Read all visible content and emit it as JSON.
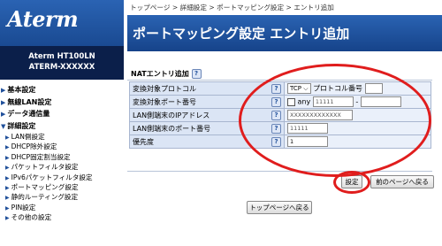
{
  "sidebar": {
    "logo": "Aterm",
    "model_line1": "Aterm  HT100LN",
    "model_line2": "ATERM-XXXXXX",
    "items": [
      {
        "label": "基本設定"
      },
      {
        "label": "無線LAN設定"
      },
      {
        "label": "データ通信量"
      },
      {
        "label": "詳細設定"
      }
    ],
    "sub_items": [
      {
        "label": "LAN側設定"
      },
      {
        "label": "DHCP除外設定"
      },
      {
        "label": "DHCP固定割当設定"
      },
      {
        "label": "パケットフィルタ設定"
      },
      {
        "label": "IPv6パケットフィルタ設定"
      },
      {
        "label": "ポートマッピング設定"
      },
      {
        "label": "静的ルーティング設定"
      },
      {
        "label": "PIN設定"
      },
      {
        "label": "その他の設定"
      }
    ]
  },
  "breadcrumb": "トップページ > 詳細設定 > ポートマッピング設定 > エントリ追加",
  "header": {
    "title": "ポートマッピング設定 エントリ追加"
  },
  "section": {
    "title": "NATエントリ追加",
    "help": "?"
  },
  "form": {
    "protocol_label": "変換対象プロトコル",
    "protocol_value": "TCP",
    "protocol_number_label": "プロトコル番号",
    "port_label": "変換対象ポート番号",
    "any_label": "any",
    "port_from": "11111",
    "port_sep": "-",
    "ip_label": "LAN側端末のIPアドレス",
    "ip_value": "XXXXXXXXXXXXX",
    "lan_port_label": "LAN側端末のポート番号",
    "lan_port_value": "11111",
    "priority_label": "優先度",
    "priority_value": "1"
  },
  "buttons": {
    "set": "設定",
    "back": "前のページへ戻る",
    "top": "トップページへ戻る"
  },
  "colors": {
    "accent": "#1f4f9a",
    "highlight": "#e01d1d"
  }
}
